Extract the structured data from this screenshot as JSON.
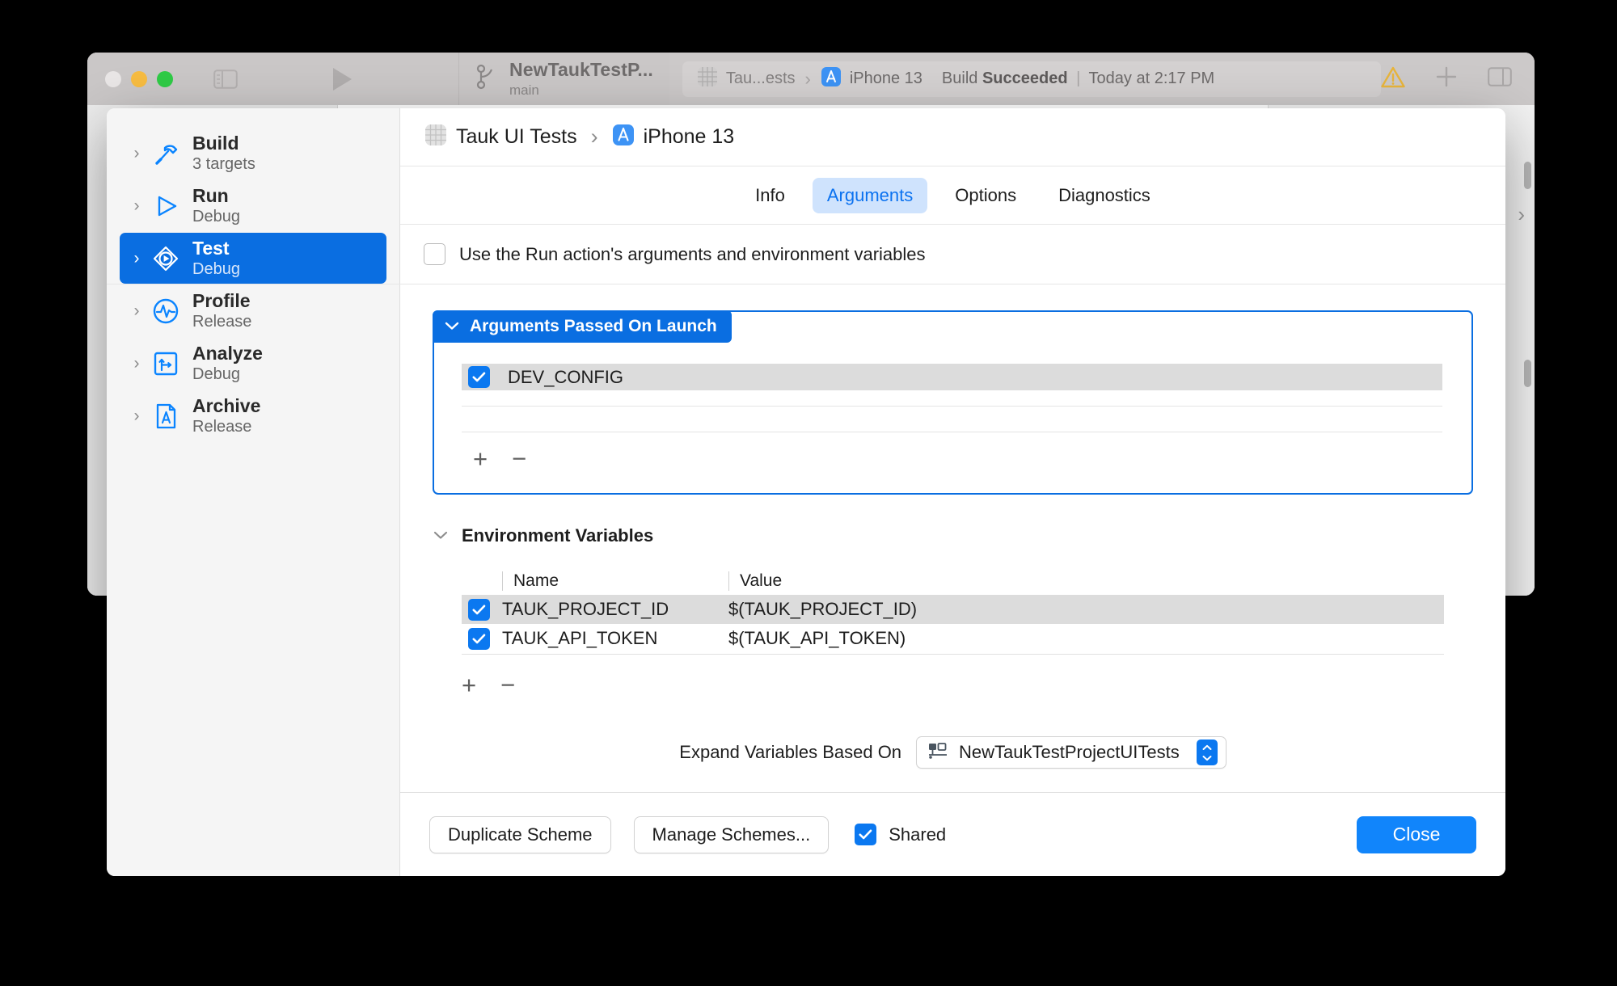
{
  "window": {
    "toolbar": {
      "scheme_name": "NewTaukTestP...",
      "branch": "main",
      "status_target": "Tau...ests",
      "status_device": "iPhone 13",
      "status_build_prefix": "Build",
      "status_build_state": "Succeeded",
      "status_time": "Today at 2:17 PM",
      "warning_icon": "warning-triangle-icon",
      "add_icon": "plus-icon",
      "sidebar_left_icon": "left-sidebar-toggle-icon",
      "sidebar_right_icon": "right-sidebar-toggle-icon",
      "run_icon": "play-icon",
      "branch_icon": "git-branch-icon",
      "target_icon": "target-grid-icon",
      "device_icon": "app-store-icon"
    }
  },
  "sheet": {
    "sidebar": {
      "items": [
        {
          "title": "Build",
          "subtitle": "3 targets",
          "icon": "hammer-icon",
          "selected": false
        },
        {
          "title": "Run",
          "subtitle": "Debug",
          "icon": "play-triangle-icon",
          "selected": false
        },
        {
          "title": "Test",
          "subtitle": "Debug",
          "icon": "test-diamond-icon",
          "selected": true
        },
        {
          "title": "Profile",
          "subtitle": "Release",
          "icon": "profile-wave-icon",
          "selected": false
        },
        {
          "title": "Analyze",
          "subtitle": "Debug",
          "icon": "analyze-icon",
          "selected": false
        },
        {
          "title": "Archive",
          "subtitle": "Release",
          "icon": "archive-icon",
          "selected": false
        }
      ]
    },
    "header": {
      "scheme": "Tauk UI Tests",
      "destination": "iPhone 13",
      "separator": "›",
      "scheme_icon": "scheme-grid-icon",
      "destination_icon": "app-store-icon"
    },
    "tabs": [
      {
        "label": "Info",
        "active": false
      },
      {
        "label": "Arguments",
        "active": true
      },
      {
        "label": "Options",
        "active": false
      },
      {
        "label": "Diagnostics",
        "active": false
      }
    ],
    "use_run_action": {
      "label": "Use the Run action's arguments and environment variables",
      "checked": false
    },
    "arguments_section": {
      "title": "Arguments Passed On Launch",
      "chevron": "chevron-down-icon",
      "rows": [
        {
          "name": "DEV_CONFIG",
          "checked": true,
          "selected": true
        }
      ],
      "add_label": "+",
      "remove_label": "−"
    },
    "environment_section": {
      "title": "Environment Variables",
      "chevron": "chevron-down-icon",
      "columns": [
        "Name",
        "Value"
      ],
      "rows": [
        {
          "name": "TAUK_PROJECT_ID",
          "value": "$(TAUK_PROJECT_ID)",
          "checked": true,
          "selected": true
        },
        {
          "name": "TAUK_API_TOKEN",
          "value": "$(TAUK_API_TOKEN)",
          "checked": true,
          "selected": false
        }
      ],
      "add_label": "+",
      "remove_label": "−"
    },
    "expand_variables": {
      "label": "Expand Variables Based On",
      "value": "NewTaukTestProjectUITests",
      "icon": "target-membership-icon"
    },
    "footer": {
      "duplicate_scheme": "Duplicate Scheme",
      "manage_schemes": "Manage Schemes...",
      "shared_label": "Shared",
      "shared_checked": true,
      "close": "Close"
    }
  },
  "colors": {
    "accent_blue": "#0a6ee1",
    "tab_active_bg": "#cfe3fd",
    "tab_active_text": "#0b72f0",
    "checkbox_blue": "#0b78f0",
    "close_blue": "#1185fb",
    "row_selected": "#dcdcdc"
  }
}
